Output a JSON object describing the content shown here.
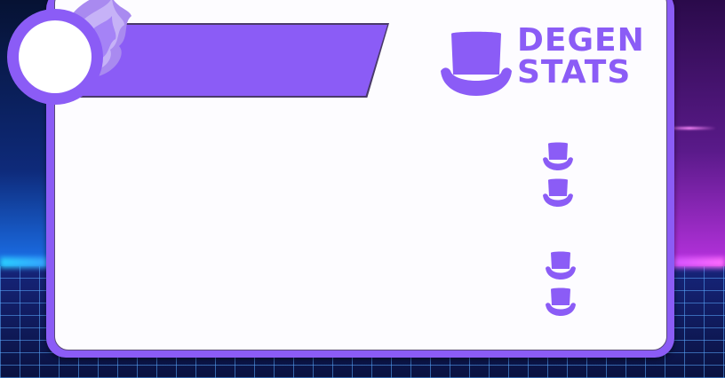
{
  "logo": {
    "line1": "DEGEN",
    "line2": "STATS",
    "icon": "top-hat-icon"
  },
  "icons": {
    "avatar": "avatar-flame",
    "stat_icon": "top-hat-icon"
  },
  "colors": {
    "accent": "#8b5cf6",
    "card": "#fdfcff",
    "outline": "#4a3a6a"
  }
}
